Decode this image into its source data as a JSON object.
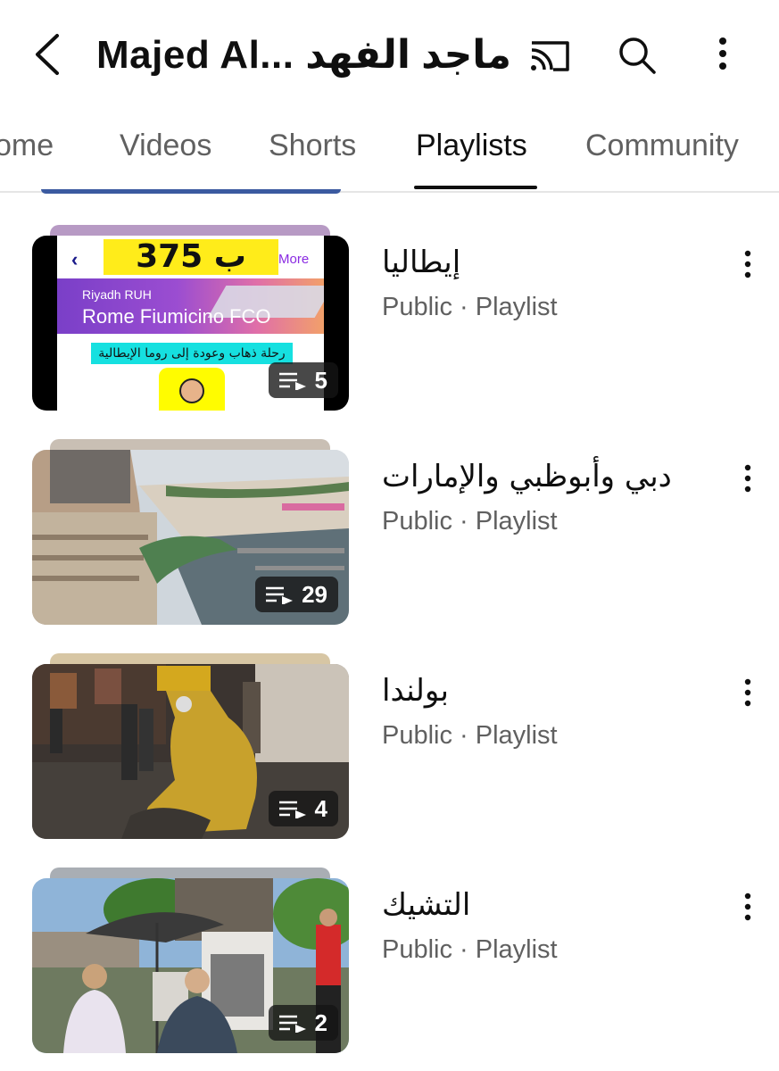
{
  "header": {
    "title": "Majed Al... ماجد الفهد",
    "icons": [
      "back-icon",
      "cast-icon",
      "search-icon",
      "more-vert-icon"
    ]
  },
  "tabs": [
    {
      "label": "Home",
      "visible_text": "ome",
      "active": false
    },
    {
      "label": "Videos",
      "active": false
    },
    {
      "label": "Shorts",
      "active": false
    },
    {
      "label": "Playlists",
      "active": true
    },
    {
      "label": "Community",
      "active": false
    }
  ],
  "playlists": [
    {
      "title": "إيطاليا",
      "meta": "Public · Playlist",
      "count": "5",
      "thumbnail": {
        "price": "ب 375 ريال",
        "more": "More",
        "from": "Riyadh RUH",
        "destination": "Rome Fiumicino FCO",
        "caption": "رحلة ذهاب وعودة إلى روما الإيطالية"
      }
    },
    {
      "title": "دبي وأبوظبي والإمارات",
      "meta": "Public · Playlist",
      "count": "29"
    },
    {
      "title": "بولندا",
      "meta": "Public · Playlist",
      "count": "4"
    },
    {
      "title": "التشيك",
      "meta": "Public · Playlist",
      "count": "2"
    }
  ],
  "colors": {
    "text_primary": "#0f0f0f",
    "text_secondary": "#606060",
    "divider": "#e5e5e5"
  }
}
